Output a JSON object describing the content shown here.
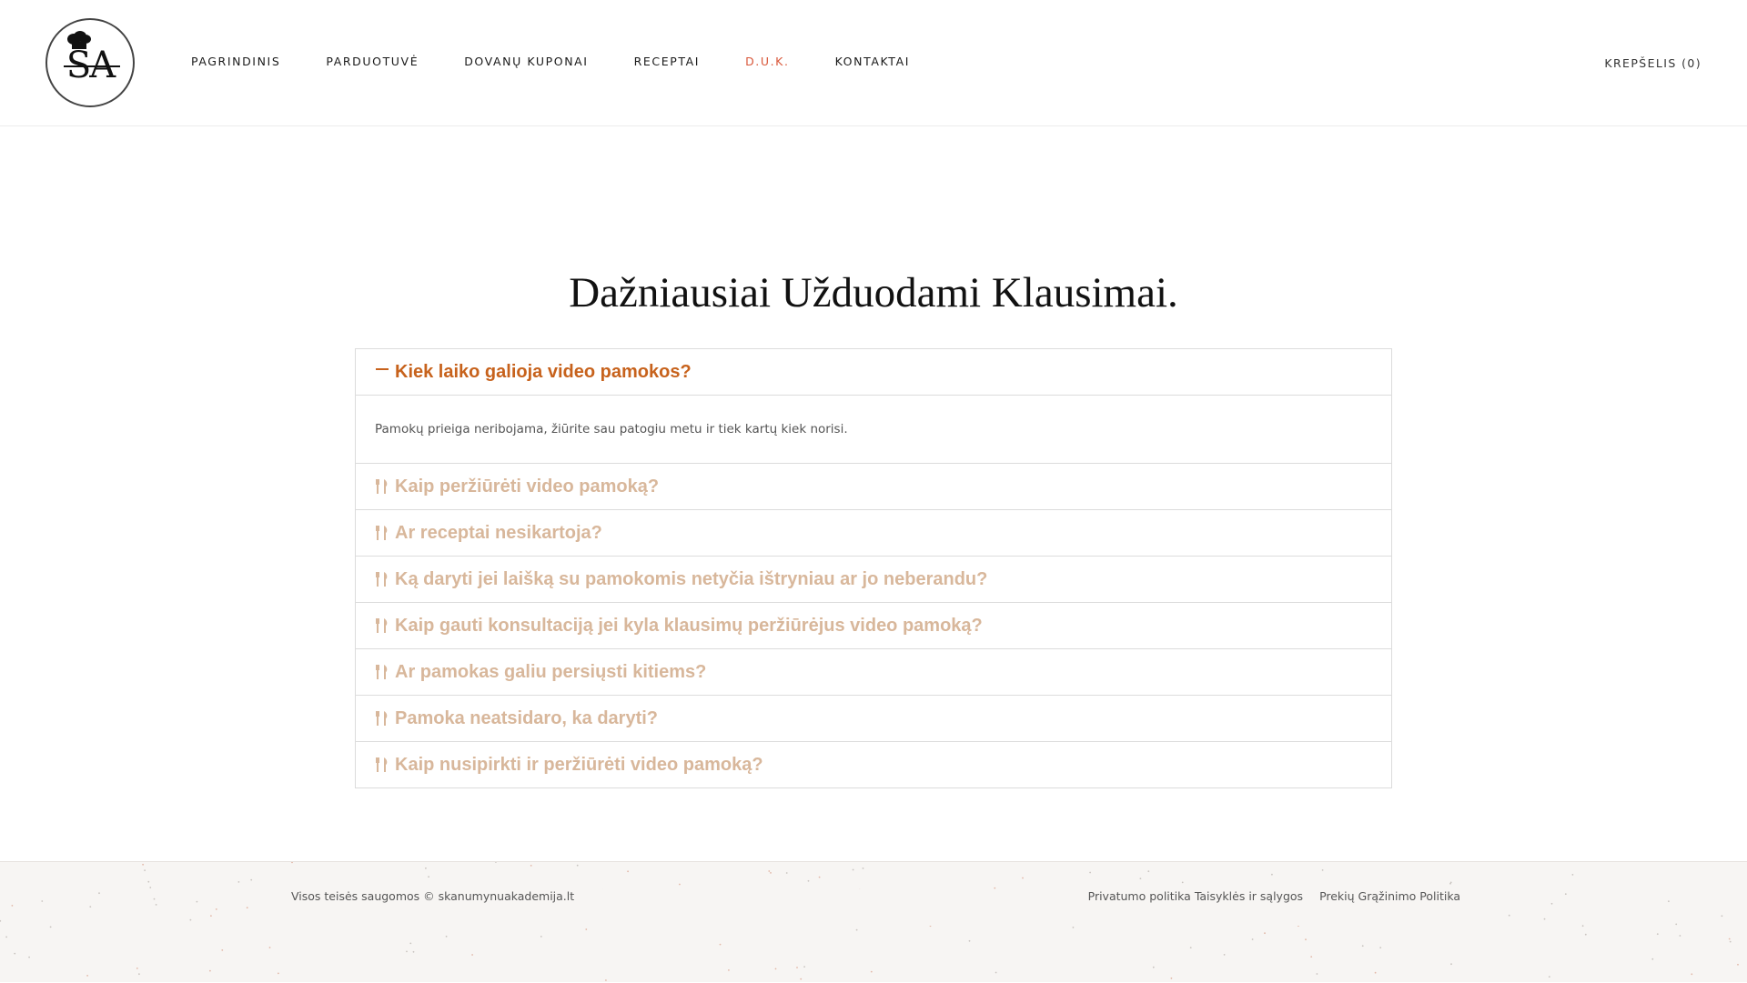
{
  "header": {
    "logo_text": "SA",
    "nav": [
      {
        "label": "PAGRINDINIS",
        "active": false
      },
      {
        "label": "PARDUOTUVĖ",
        "active": false
      },
      {
        "label": "DOVANŲ KUPONAI",
        "active": false
      },
      {
        "label": "RECEPTAI",
        "active": false
      },
      {
        "label": "D.U.K.",
        "active": true
      },
      {
        "label": "KONTAKTAI",
        "active": false
      }
    ],
    "cart_label": "KREPŠELIS (0)"
  },
  "main": {
    "title": "Dažniausiai Užduodami Klausimai.",
    "faq": [
      {
        "question": "Kiek laiko galioja video pamokos?",
        "answer": "Pamokų prieiga neribojama, žiūrite sau patogiu metu ir tiek kartų kiek norisi.",
        "open": true
      },
      {
        "question": "Kaip peržiūrėti video pamoką?",
        "open": false
      },
      {
        "question": "Ar receptai nesikartoja?",
        "open": false
      },
      {
        "question": "Ką daryti jei laišką su pamokomis netyčia ištryniau ar jo neberandu?",
        "open": false
      },
      {
        "question": "Kaip gauti konsultaciją jei kyla klausimų peržiūrėjus video pamoką?",
        "open": false
      },
      {
        "question": "Ar pamokas galiu persiųsti kitiems?",
        "open": false
      },
      {
        "question": "Pamoka neatsidaro, ka daryti?",
        "open": false
      },
      {
        "question": "Kaip nusipirkti ir peržiūrėti video pamoką?",
        "open": false
      }
    ]
  },
  "footer": {
    "copyright": "Visos teisės saugomos © skanumynuakademija.lt",
    "links": [
      "Privatumo politika",
      "Taisyklės ir sąlygos",
      "Prekių Grąžinimo Politika"
    ]
  },
  "colors": {
    "accent_active": "#c7621c",
    "accent_inactive": "#d8b79b",
    "nav_active": "#d9583b"
  }
}
